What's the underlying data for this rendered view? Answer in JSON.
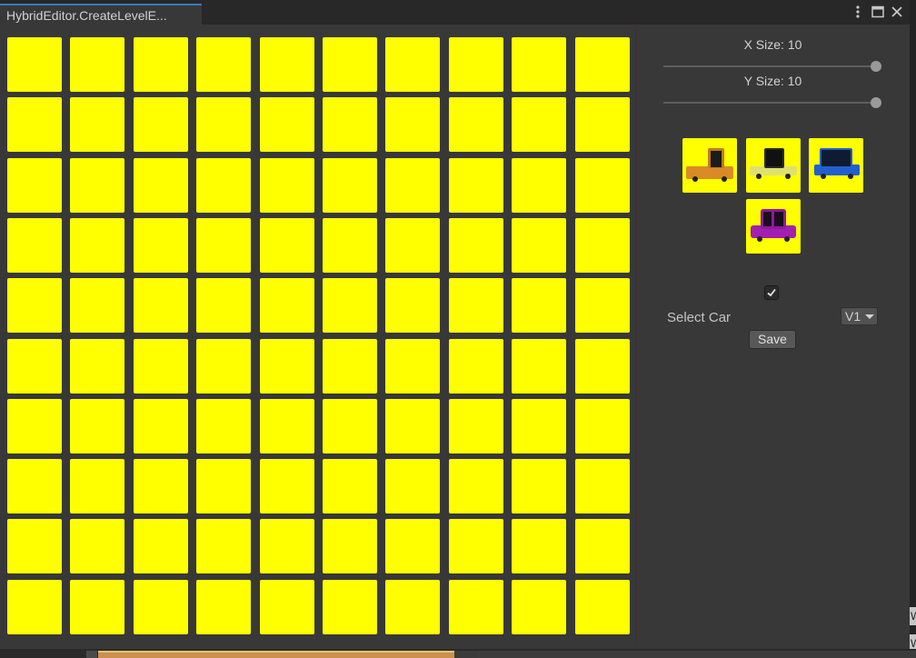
{
  "window": {
    "tab_title": "HybridEditor.CreateLevelE..."
  },
  "controls": {
    "x_size_label": "X Size: 10",
    "y_size_label": "Y Size: 10",
    "x_size_value": 10,
    "y_size_value": 10,
    "slider_max_fraction": 1.0,
    "checkbox_checked": true,
    "select_label": "Select Car",
    "dropdown_value": "V1",
    "save_label": "Save"
  },
  "grid": {
    "columns": 10,
    "rows": 10,
    "cell_color": "#ffff00"
  },
  "cars": [
    {
      "name": "orange-car-icon",
      "color": "#d98b25"
    },
    {
      "name": "yellow-car-icon",
      "color": "#e0e070"
    },
    {
      "name": "blue-car-icon",
      "color": "#1f5fd0"
    },
    {
      "name": "purple-car-icon",
      "color": "#a21fb0"
    }
  ],
  "edge_labels": [
    "W",
    "W"
  ],
  "colors": {
    "background": "#383838",
    "accent_line": "#b00000",
    "tab_highlight": "#3a79bb"
  }
}
